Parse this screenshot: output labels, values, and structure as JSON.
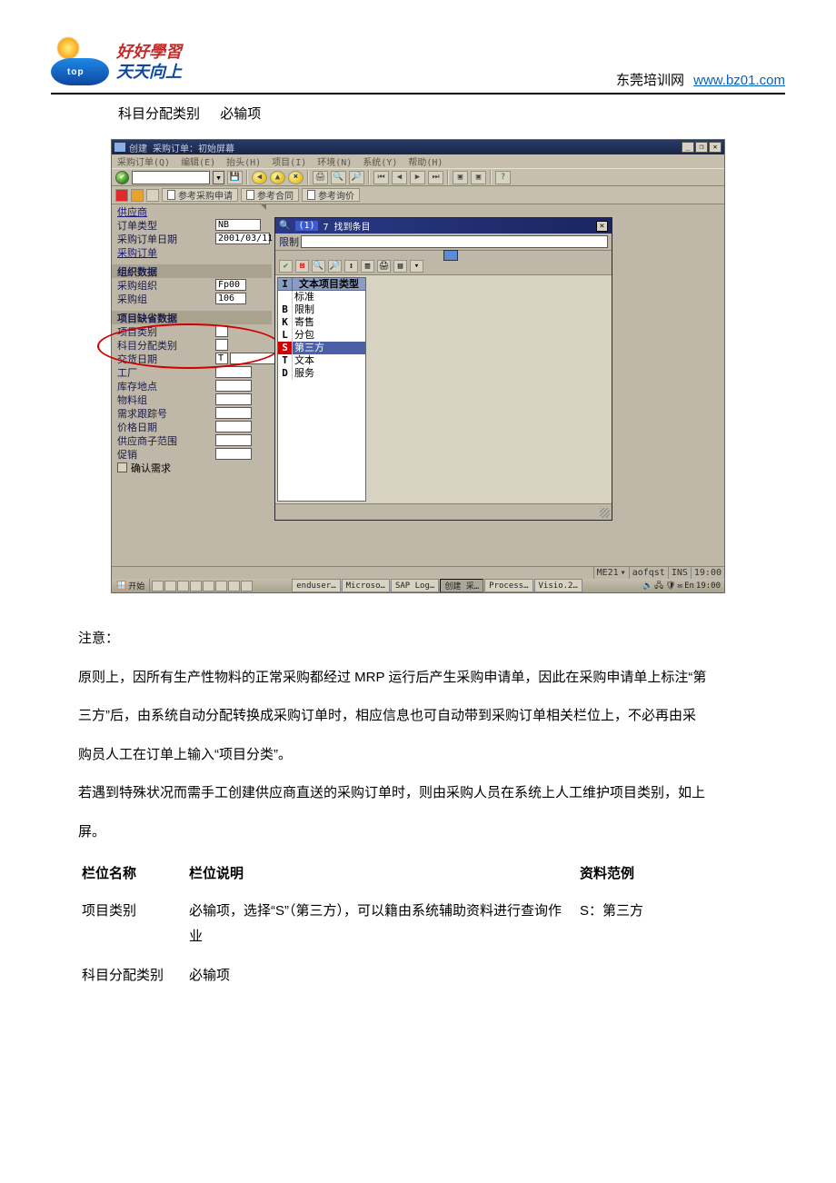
{
  "header": {
    "slogan_line1": "好好學習",
    "slogan_line2": "天天向上",
    "logo_text": "top",
    "right_text": "东莞培训网",
    "site_url": "www.bz01.com"
  },
  "topline": {
    "a": "科目分配类别",
    "b": "必输项"
  },
  "sap": {
    "window_title": "创建 采购订单：初始屏幕",
    "menu": [
      "采购订单(Q)",
      "编辑(E)",
      "抬头(H)",
      "项目(I)",
      "环境(N)",
      "系统(Y)",
      "帮助(H)"
    ],
    "app_buttons": {
      "req": "参考采购申请",
      "contract": "参考合同",
      "quote": "参考询价"
    },
    "form": {
      "supplier": "供应商",
      "order_type": "订单类型",
      "order_type_val": "NB",
      "po_date": "采购订单日期",
      "po_date_val": "2001/03/11",
      "po": "采购订单",
      "grp_org": "组织数据",
      "purch_org": "采购组织",
      "purch_org_val": "Fp00",
      "purch_grp": "采购组",
      "purch_grp_val": "106",
      "grp_def": "项目缺省数据",
      "item_cat": "项目类别",
      "acct_assign": "科目分配类别",
      "deliv_date": "交货日期",
      "deliv_date_val": "T",
      "plant": "工厂",
      "storage": "库存地点",
      "matgrp": "物料组",
      "reqtrack": "需求跟踪号",
      "pricedate": "价格日期",
      "vendor_sub": "供应商子范围",
      "promo": "促销",
      "confirm": "确认需求"
    },
    "popup": {
      "tag": "(1)",
      "hits": "7 找到条目",
      "limit_lbl": "限制",
      "header": {
        "c1": "I",
        "c2": "文本项目类型"
      },
      "rows": [
        {
          "c1": "",
          "c2": "标准"
        },
        {
          "c1": "B",
          "c2": "限制"
        },
        {
          "c1": "K",
          "c2": "寄售"
        },
        {
          "c1": "L",
          "c2": "分包"
        },
        {
          "c1": "S",
          "c2": "第三方",
          "selected": true
        },
        {
          "c1": "T",
          "c2": "文本"
        },
        {
          "c1": "D",
          "c2": "服务"
        }
      ]
    },
    "status": {
      "tx": "ME21",
      "srv": "aofqst",
      "ovr": "INS",
      "time": "19:00"
    },
    "taskbar": {
      "start": "开始",
      "tasks": [
        "enduser…",
        "Microso…",
        "SAP Log…",
        "创建 采…",
        "Process…",
        "Visio.2…"
      ],
      "tray_time": "19:00",
      "tray_lang": "En"
    }
  },
  "body": {
    "note": "注意：",
    "p1": "原则上，因所有生产性物料的正常采购都经过 MRP 运行后产生采购申请单，因此在采购申请单上标注“第",
    "p2": "三方”后，由系统自动分配转换成采购订单时，相应信息也可自动带到采购订单相关栏位上，不必再由采",
    "p3": "购员人工在订单上输入“项目分类”。",
    "p4": "若遇到特殊状况而需手工创建供应商直送的采购订单时，则由采购人员在系统上人工维护项目类别，如上",
    "p5": "屏。"
  },
  "table": {
    "h1": "栏位名称",
    "h2": "栏位说明",
    "h3": "资料范例",
    "rows": [
      {
        "a": "项目类别",
        "b": "必输项，选择“S”（第三方），可以籍由系统辅助资料进行查询作业",
        "c": "S：第三方"
      },
      {
        "a": "科目分配类别",
        "b": "必输项",
        "c": ""
      }
    ]
  }
}
